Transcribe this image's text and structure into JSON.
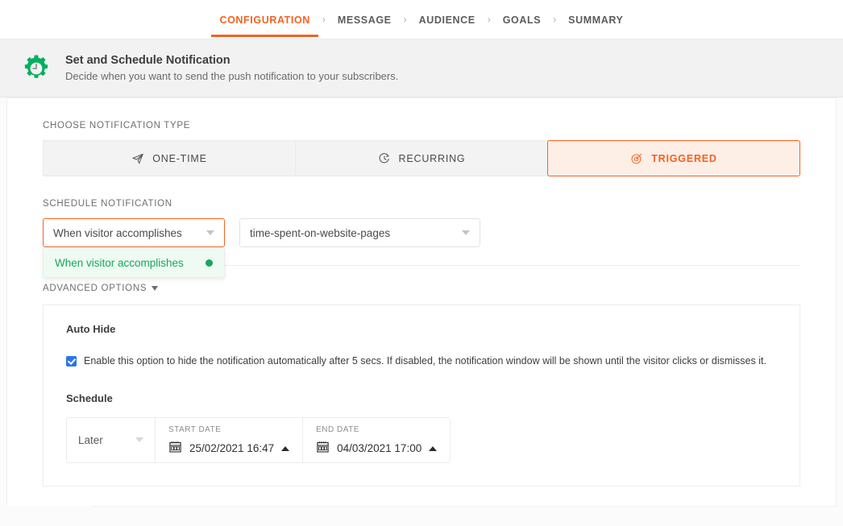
{
  "steps": {
    "items": [
      {
        "label": "CONFIGURATION",
        "active": true
      },
      {
        "label": "MESSAGE",
        "active": false
      },
      {
        "label": "AUDIENCE",
        "active": false
      },
      {
        "label": "GOALS",
        "active": false
      },
      {
        "label": "SUMMARY",
        "active": false
      }
    ],
    "separator": "›"
  },
  "header": {
    "icon": "gear-clock-icon",
    "title": "Set and Schedule Notification",
    "subtitle": "Decide when you want to send the push notification to your subscribers."
  },
  "notification_type": {
    "label": "CHOOSE NOTIFICATION TYPE",
    "tabs": [
      {
        "label": "ONE-TIME",
        "icon": "paper-plane-icon",
        "selected": false
      },
      {
        "label": "RECURRING",
        "icon": "clock-arrow-icon",
        "selected": false
      },
      {
        "label": "TRIGGERED",
        "icon": "target-icon",
        "selected": true
      }
    ]
  },
  "schedule_notification": {
    "label": "SCHEDULE NOTIFICATION",
    "trigger_type": {
      "value": "When visitor accomplishes",
      "open": true,
      "options": [
        {
          "label": "When visitor accomplishes",
          "selected": true
        }
      ]
    },
    "trigger_event": {
      "value": "time-spent-on-website-pages"
    }
  },
  "advanced_options": {
    "label": "ADVANCED OPTIONS",
    "auto_hide": {
      "title": "Auto Hide",
      "checkbox_checked": true,
      "description": "Enable this option to hide the notification automatically after 5 secs. If disabled, the notification window will be shown until the visitor clicks or dismisses it."
    },
    "schedule": {
      "title": "Schedule",
      "when": "Later",
      "start": {
        "caption": "START DATE",
        "value": "25/02/2021 16:47"
      },
      "end": {
        "caption": "END DATE",
        "value": "04/03/2021 17:00"
      }
    }
  },
  "colors": {
    "accent_orange": "#f4621f",
    "accent_orange_bg": "#fdeee6",
    "green": "#16a75a",
    "green_bg": "#eefaf2",
    "checkbox_blue": "#2a74f0"
  }
}
